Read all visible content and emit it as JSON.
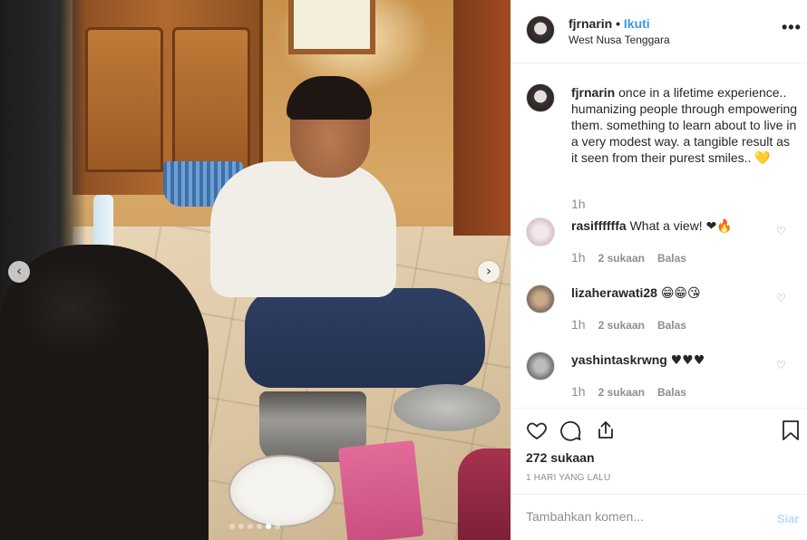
{
  "post": {
    "username": "fjrnarin",
    "dot": "•",
    "follow_label": "Ikuti",
    "location": "West Nusa Tenggara",
    "more_label": "•••"
  },
  "caption": {
    "username": "fjrnarin",
    "text": "once in a lifetime experience.. humanizing people through empowering them. something to learn about to live in a very modest way. a tangible result as it seen from their purest smiles..",
    "emoji": "💛",
    "time": "1h"
  },
  "comments": [
    {
      "username": "rasiffffffa",
      "text": "What a view!",
      "emoji": "❤🔥",
      "time": "1h",
      "likes": "2 sukaan",
      "reply": "Balas"
    },
    {
      "username": "lizaherawati28",
      "text": "",
      "emoji": "😁😁😘",
      "time": "1h",
      "likes": "2 sukaan",
      "reply": "Balas"
    },
    {
      "username": "yashintaskrwng",
      "text": "♥♥♥",
      "emoji": "",
      "time": "1h",
      "likes": "2 sukaan",
      "reply": "Balas"
    }
  ],
  "actions": {
    "likes_count": "272 sukaan",
    "date": "1 HARI YANG LALU"
  },
  "add_comment": {
    "placeholder": "Tambahkan komen...",
    "post_label": "Siar"
  },
  "carousel": {
    "prev_icon": "‹",
    "next_icon": "›",
    "slide_count": 6,
    "active_slide": 5
  },
  "colors": {
    "link_blue": "#3897f0",
    "post_disabled": "#b3dbff",
    "meta_gray": "#8e8e8e"
  }
}
